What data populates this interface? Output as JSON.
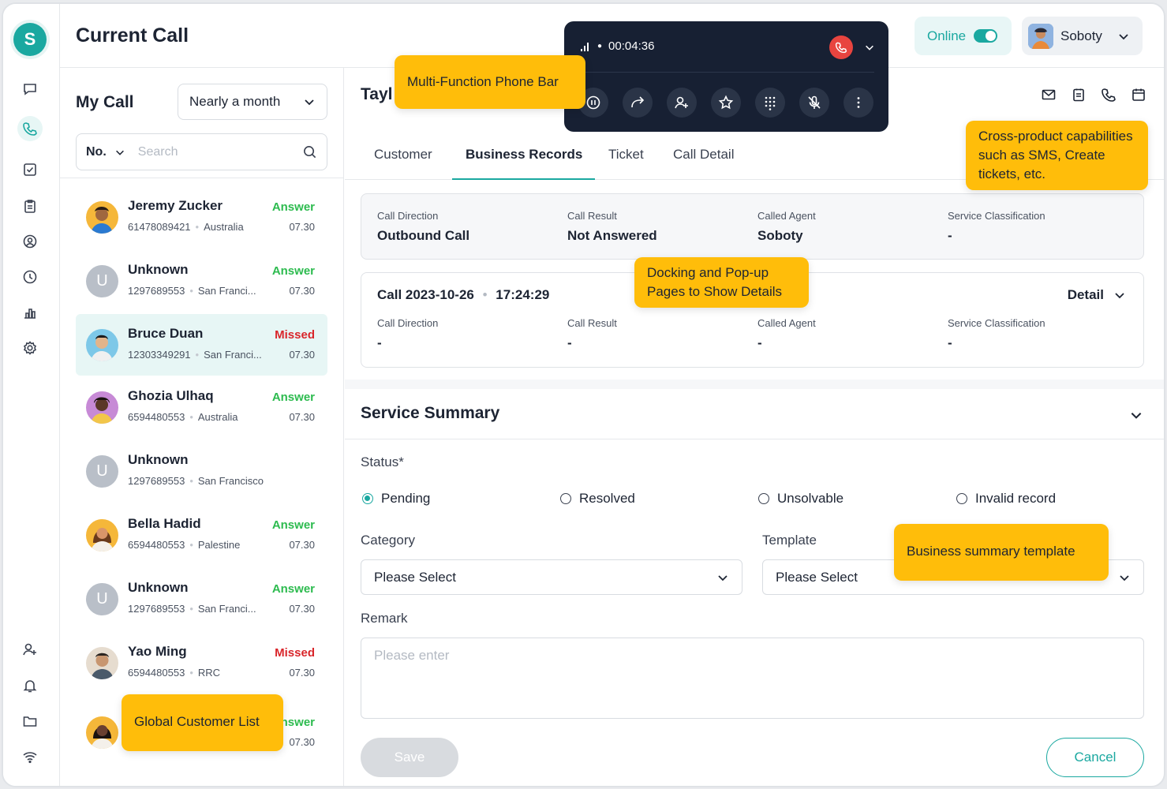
{
  "header": {
    "title": "Current Call",
    "status_label": "Online",
    "user_name": "Soboty"
  },
  "call_list": {
    "title": "My Call",
    "range": "Nearly a month",
    "search_prefix": "No.",
    "search_placeholder": "Search",
    "items": [
      {
        "name": "Jeremy Zucker",
        "number": "61478089421",
        "location": "Australia",
        "status": "Answer",
        "time": "07.30",
        "avatar": "photo"
      },
      {
        "name": "Unknown",
        "number": "1297689553",
        "location": "San Franci...",
        "status": "Answer",
        "time": "07.30",
        "avatar": "U"
      },
      {
        "name": "Bruce Duan",
        "number": "12303349291",
        "location": "San Franci...",
        "status": "Missed",
        "time": "07.30",
        "avatar": "photo"
      },
      {
        "name": "Ghozia Ulhaq",
        "number": "6594480553",
        "location": "Australia",
        "status": "Answer",
        "time": "07.30",
        "avatar": "photo"
      },
      {
        "name": "Unknown",
        "number": "1297689553",
        "location": "San Francisco",
        "status": "",
        "time": "",
        "avatar": "U"
      },
      {
        "name": "Bella Hadid",
        "number": "6594480553",
        "location": "Palestine",
        "status": "Answer",
        "time": "07.30",
        "avatar": "photo"
      },
      {
        "name": "Unknown",
        "number": "1297689553",
        "location": "San Franci...",
        "status": "Answer",
        "time": "07.30",
        "avatar": "U"
      },
      {
        "name": "Yao Ming",
        "number": "6594480553",
        "location": "RRC",
        "status": "Missed",
        "time": "07.30",
        "avatar": "photo"
      },
      {
        "name": "",
        "number": "",
        "location": "",
        "status": "nswer",
        "time": "07.30",
        "avatar": "photo"
      }
    ]
  },
  "main": {
    "caller_name": "Tayl",
    "tabs": [
      "Customer",
      "Business Records",
      "Ticket",
      "Call Detail"
    ],
    "active_tab": "Business Records",
    "current_record": {
      "call_direction_label": "Call Direction",
      "call_direction": "Outbound Call",
      "call_result_label": "Call Result",
      "call_result": "Not Answered",
      "called_agent_label": "Called Agent",
      "called_agent": "Soboty",
      "service_classification_label": "Service Classification",
      "service_classification": "-"
    },
    "history_record": {
      "title": "Call 2023-10-26",
      "time": "17:24:29",
      "detail_label": "Detail",
      "call_direction_label": "Call Direction",
      "call_direction": "-",
      "call_result_label": "Call Result",
      "call_result": "-",
      "called_agent_label": "Called Agent",
      "called_agent": "-",
      "service_classification_label": "Service Classification",
      "service_classification": "-"
    },
    "summary": {
      "title": "Service Summary",
      "status_label": "Status*",
      "statuses": [
        "Pending",
        "Resolved",
        "Unsolvable",
        "Invalid record"
      ],
      "selected_status": "Pending",
      "category_label": "Category",
      "category_value": "Please Select",
      "template_label": "Template",
      "template_value": "Please Select",
      "remark_label": "Remark",
      "remark_placeholder": "Please enter",
      "save_label": "Save",
      "cancel_label": "Cancel"
    }
  },
  "phone_bar": {
    "timer": "00:04:36"
  },
  "callouts": {
    "phone_bar": "Multi-Function Phone Bar",
    "cross_product": "Cross-product capabilities such as SMS, Create tickets, etc.",
    "docking": "Docking and Pop-up Pages to Show Details",
    "template": "Business summary template",
    "customer_list": "Global Customer List"
  },
  "colors": {
    "accent": "#1aa8a0",
    "answer": "#2dbb4f",
    "missed": "#d9262b",
    "callout": "#ffbd0a",
    "phone_bar_bg": "#172033"
  },
  "icons": {
    "rail_top": [
      "chat-icon",
      "phone-icon",
      "task-icon",
      "clipboard-icon",
      "contact-icon",
      "history-icon",
      "chart-icon",
      "settings-icon"
    ],
    "rail_bottom": [
      "user-add-icon",
      "bell-icon",
      "folder-icon",
      "wifi-icon"
    ],
    "top_actions": [
      "mail-icon",
      "note-icon",
      "phone-icon",
      "calendar-icon"
    ],
    "phone_bar": [
      "pause-icon",
      "forward-icon",
      "transfer-icon",
      "star-icon",
      "keypad-icon",
      "mute-icon",
      "more-icon"
    ]
  }
}
